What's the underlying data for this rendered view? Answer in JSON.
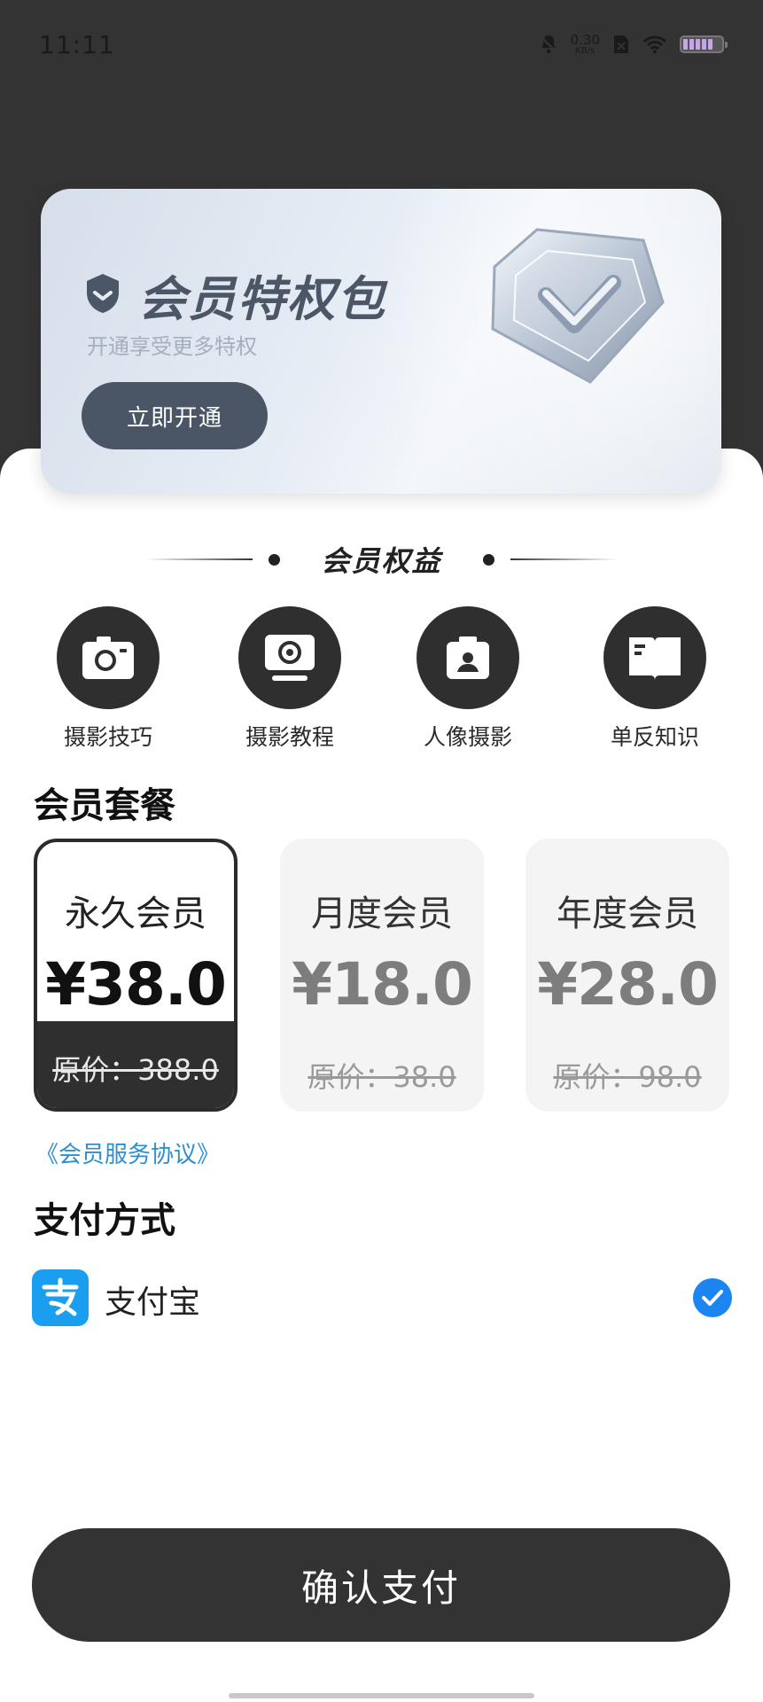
{
  "status_bar": {
    "time": "11:11",
    "net_speed_value": "0.30",
    "net_speed_unit": "KB/s",
    "icons": [
      "mute-icon",
      "sim-icon",
      "wifi-icon",
      "battery-icon"
    ]
  },
  "banner": {
    "title": "会员特权包",
    "subtitle": "开通享受更多特权",
    "open_button": "立即开通",
    "icons": [
      "shield-icon",
      "gem-check-icon"
    ]
  },
  "benefits": {
    "title": "会员权益",
    "items": [
      {
        "label": "摄影技巧",
        "icon": "camera-icon"
      },
      {
        "label": "摄影教程",
        "icon": "webcam-icon"
      },
      {
        "label": "人像摄影",
        "icon": "portrait-icon"
      },
      {
        "label": "单反知识",
        "icon": "book-icon"
      }
    ]
  },
  "plans": {
    "title": "会员套餐",
    "items": [
      {
        "name": "永久会员",
        "price": "¥38.0",
        "original": "原价：388.0",
        "selected": true
      },
      {
        "name": "月度会员",
        "price": "¥18.0",
        "original": "原价：38.0",
        "selected": false
      },
      {
        "name": "年度会员",
        "price": "¥28.0",
        "original": "原价：98.0",
        "selected": false
      }
    ]
  },
  "agreement": "《会员服务协议》",
  "payment": {
    "title": "支付方式",
    "method": "支付宝",
    "selected": true,
    "logo_color": "#1a9ff0",
    "check_color": "#1b86f2"
  },
  "confirm_button": "确认支付",
  "colors": {
    "dark": "#333333",
    "link": "#2d8fd3",
    "banner_text": "#4b5666"
  }
}
